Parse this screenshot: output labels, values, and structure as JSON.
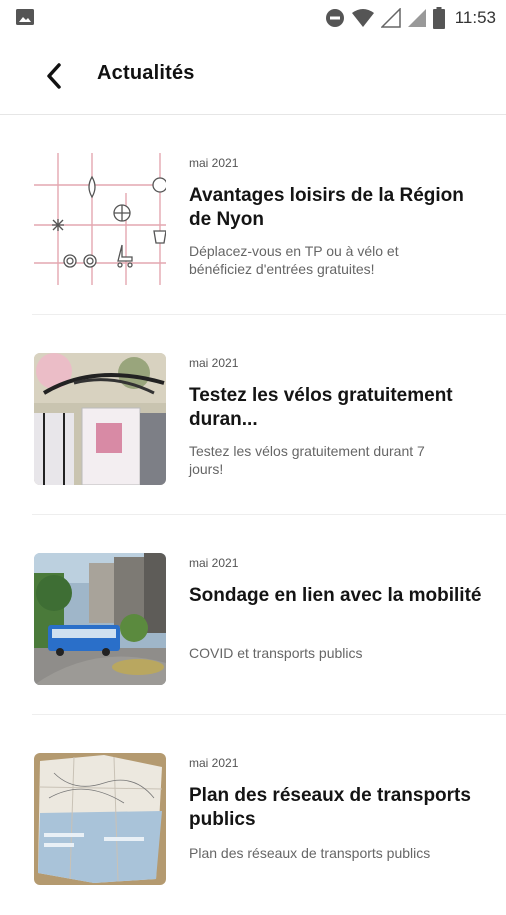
{
  "status_bar": {
    "time": "11:53",
    "icons": [
      "image-icon",
      "do-not-disturb-icon",
      "wifi-icon",
      "signal-icon",
      "signal-icon",
      "battery-icon"
    ]
  },
  "header": {
    "back_icon": "chevron-left-icon",
    "title": "Actualités"
  },
  "news": [
    {
      "date": "mai 2021",
      "title": "Avantages loisirs de la Région de Nyon",
      "description": "Déplacez-vous en TP ou à vélo et bénéficiez d'entrées gratuites!"
    },
    {
      "date": "mai 2021",
      "title": "Testez les vélos gratuitement duran...",
      "description": "Testez les vélos gratuitement durant 7 jours!"
    },
    {
      "date": "mai 2021",
      "title": "Sondage en lien avec la mobilité",
      "description": "COVID et transports publics"
    },
    {
      "date": "mai 2021",
      "title": "Plan des réseaux de transports publics",
      "description": "Plan des réseaux de transports publics"
    }
  ],
  "colors": {
    "accent_line": "#e0a0aa",
    "text": "#141414",
    "muted": "#666666"
  }
}
